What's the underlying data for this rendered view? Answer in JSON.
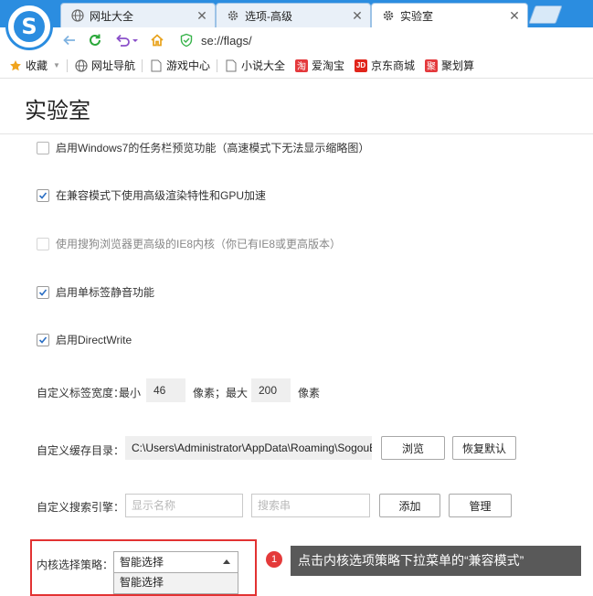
{
  "browser": {
    "tabs": [
      {
        "label": "网址大全",
        "icon": "globe-icon"
      },
      {
        "label": "选项-高级",
        "icon": "gear-icon"
      },
      {
        "label": "实验室",
        "icon": "gear-icon"
      }
    ],
    "address": "se://flags/",
    "accent": "#2b8de0"
  },
  "bookmarks": [
    {
      "label": "收藏",
      "icon": "star-icon"
    },
    {
      "label": "网址导航",
      "icon": "globe-icon"
    },
    {
      "label": "游戏中心",
      "icon": "page-icon"
    },
    {
      "label": "小说大全",
      "icon": "page-icon"
    },
    {
      "label": "爱淘宝",
      "icon": "taobao-icon",
      "badge": "淘",
      "color": "#e4393c"
    },
    {
      "label": "京东商城",
      "icon": "jd-icon",
      "badge": "JD",
      "color": "#e1251b"
    },
    {
      "label": "聚划算",
      "icon": "juhuasuan-icon",
      "badge": "聚",
      "color": "#e4393c"
    }
  ],
  "page": {
    "title": "实验室",
    "options": [
      {
        "label": "启用Windows7的任务栏预览功能（高速模式下无法显示缩略图）",
        "checked": false,
        "disabled": false
      },
      {
        "label": "在兼容模式下使用高级渲染特性和GPU加速",
        "checked": true,
        "disabled": false
      },
      {
        "label": "使用搜狗浏览器更高级的IE8内核（你已有IE8或更高版本）",
        "checked": false,
        "disabled": true
      },
      {
        "label": "启用单标签静音功能",
        "checked": true,
        "disabled": false
      },
      {
        "label": "启用DirectWrite",
        "checked": true,
        "disabled": false
      }
    ],
    "tab_width": {
      "label": "自定义标签宽度：",
      "min_label": "最小",
      "min_value": "46",
      "min_unit": "像素；最大",
      "max_value": "200",
      "max_unit": "像素"
    },
    "cache_dir": {
      "label": "自定义缓存目录：",
      "value": "C:\\Users\\Administrator\\AppData\\Roaming\\SogouExplorer",
      "browse_label": "浏览",
      "reset_label": "恢复默认"
    },
    "search_engine": {
      "label": "自定义搜索引擎：",
      "name_placeholder": "显示名称",
      "query_placeholder": "搜索串",
      "add_label": "添加",
      "manage_label": "管理"
    },
    "kernel": {
      "label": "内核选择策略：",
      "selected": "智能选择",
      "dropdown_first": "智能选择"
    }
  },
  "annotation": {
    "step": "1",
    "text": "点击内核选项策略下拉菜单的“兼容模式”"
  }
}
